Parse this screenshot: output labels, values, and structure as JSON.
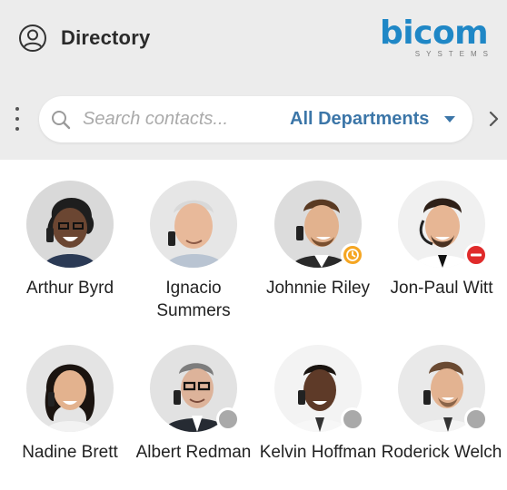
{
  "header": {
    "title": "Directory",
    "title_icon": "user-circle-icon",
    "logo": {
      "word": "bicom",
      "sub": "SYSTEMS",
      "color": "#1f87c6"
    }
  },
  "toolbar": {
    "menu_icon": "vertical-dots-icon",
    "search": {
      "placeholder": "Search contacts...",
      "value": ""
    },
    "department": {
      "selected": "All Departments"
    },
    "next_icon": "chevron-right-icon"
  },
  "colors": {
    "accent": "#3c76a8",
    "away": "#f5a623",
    "dnd": "#e02b2b",
    "offline": "#a9a9a9"
  },
  "contacts": [
    {
      "name": "Arthur Byrd",
      "status": "none"
    },
    {
      "name": "Ignacio Summers",
      "status": "none"
    },
    {
      "name": "Johnnie Riley",
      "status": "away"
    },
    {
      "name": "Jon-Paul Witt",
      "status": "dnd"
    },
    {
      "name": "Nadine Brett",
      "status": "none"
    },
    {
      "name": "Albert Redman",
      "status": "offline"
    },
    {
      "name": "Kelvin Hoffman",
      "status": "offline"
    },
    {
      "name": "Roderick Welch",
      "status": "offline"
    }
  ]
}
